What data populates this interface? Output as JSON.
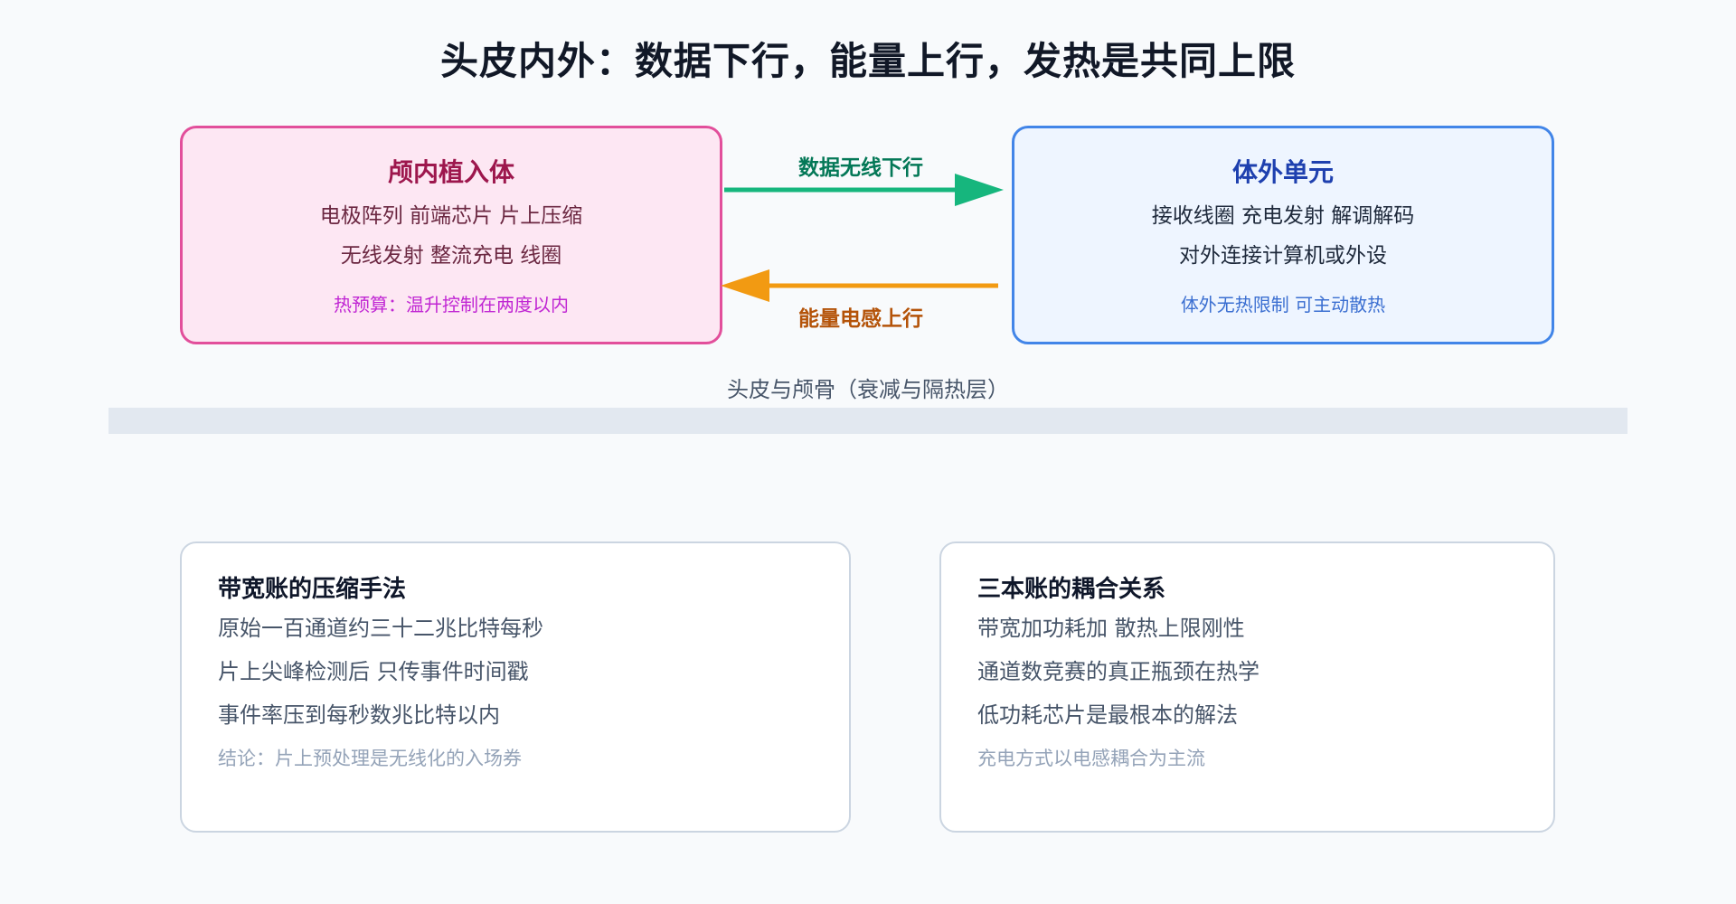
{
  "title": "头皮内外：数据下行，能量上行，发热是共同上限",
  "implant": {
    "title": "颅内植入体",
    "line1": "电极阵列 前端芯片 片上压缩",
    "line2": "无线发射 整流充电 线圈",
    "note": "热预算：温升控制在两度以内"
  },
  "external": {
    "title": "体外单元",
    "line1": "接收线圈 充电发射 解调解码",
    "line2": "对外连接计算机或外设",
    "note": "体外无热限制 可主动散热"
  },
  "arrows": {
    "data_down": "数据无线下行",
    "energy_up": "能量电感上行"
  },
  "layer": {
    "label": "头皮与颅骨（衰减与隔热层）"
  },
  "cards": {
    "left": {
      "title": "带宽账的压缩手法",
      "items": [
        "原始一百通道约三十二兆比特每秒",
        "片上尖峰检测后 只传事件时间戳",
        "事件率压到每秒数兆比特以内"
      ],
      "conclusion": "结论：片上预处理是无线化的入场券"
    },
    "right": {
      "title": "三本账的耦合关系",
      "items": [
        "带宽加功耗加 散热上限刚性",
        "通道数竞赛的真正瓶颈在热学",
        "低功耗芯片是最根本的解法"
      ],
      "conclusion": "充电方式以电感耦合为主流"
    }
  },
  "colors": {
    "data_arrow": "#16b67d",
    "energy_arrow": "#f29a12",
    "implant_border": "#e24f9b",
    "external_border": "#4285e8"
  }
}
